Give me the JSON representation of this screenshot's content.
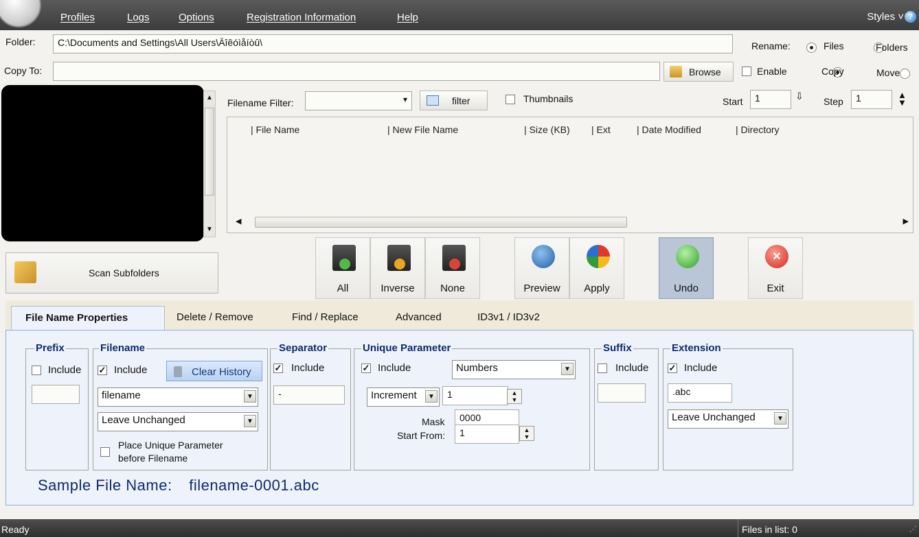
{
  "menu": {
    "items": [
      "Profiles",
      "Logs",
      "Options",
      "Registration Information",
      "Help"
    ],
    "styles_label": "Styles ˅"
  },
  "folder": {
    "label": "Folder:",
    "value": "C:\\Documents and Settings\\All Users\\Äîêóìåíòû\\"
  },
  "copy_to": {
    "label": "Copy To:",
    "value": "",
    "browse_label": "Browse"
  },
  "rename": {
    "label": "Rename:",
    "options": [
      "Files",
      "Folders"
    ],
    "selected": "Files"
  },
  "copy_mode": {
    "enable_label": "Enable",
    "options": [
      "Copy",
      "Move"
    ],
    "selected": "Copy"
  },
  "filter": {
    "label": "Filename Filter:",
    "value": "",
    "button_label": "filter",
    "thumbnails_label": "Thumbnails"
  },
  "start": {
    "label": "Start",
    "value": "1"
  },
  "step": {
    "label": "Step",
    "value": "1"
  },
  "file_list": {
    "columns": [
      "File Name",
      "New File Name",
      "Size (KB)",
      "Ext",
      "Date Modified",
      "Directory"
    ],
    "rows": []
  },
  "scan_subfolders_label": "Scan Subfolders",
  "actions": {
    "all": "All",
    "inverse": "Inverse",
    "none": "None",
    "preview": "Preview",
    "apply": "Apply",
    "undo": "Undo",
    "exit": "Exit"
  },
  "tabs": [
    "File Name Properties",
    "Delete / Remove",
    "Find / Replace",
    "Advanced",
    "ID3v1 / ID3v2"
  ],
  "active_tab": "File Name Properties",
  "prefix": {
    "title": "Prefix",
    "include_label": "Include",
    "include": false,
    "value": ""
  },
  "filename": {
    "title": "Filename",
    "include_label": "Include",
    "include": true,
    "clear_history_label": "Clear History",
    "name_value": "filename",
    "case_value": "Leave Unchanged",
    "place_unique_label": "Place Unique Parameter",
    "place_unique_label2": "before Filename",
    "place_unique": false
  },
  "separator": {
    "title": "Separator",
    "include_label": "Include",
    "include": true,
    "value": "-"
  },
  "unique": {
    "title": "Unique Parameter",
    "include_label": "Include",
    "include": true,
    "type_value": "Numbers",
    "mode_value": "Increment",
    "increment_value": "1",
    "mask_label": "Mask",
    "mask_value": "0000",
    "start_from_label": "Start From:",
    "start_from_value": "1"
  },
  "suffix": {
    "title": "Suffix",
    "include_label": "Include",
    "include": false,
    "value": ""
  },
  "extension": {
    "title": "Extension",
    "include_label": "Include",
    "include": true,
    "value": ".abc",
    "case_value": "Leave Unchanged"
  },
  "sample": {
    "label": "Sample File Name:",
    "value": "filename-0001.abc"
  },
  "status": {
    "left": "Ready",
    "right": "Files in list: 0"
  },
  "colors": {
    "menubar": "#454545",
    "panel": "#eef3fb",
    "group_title": "#0e2a6b",
    "tabstrip": "#f0eada"
  }
}
